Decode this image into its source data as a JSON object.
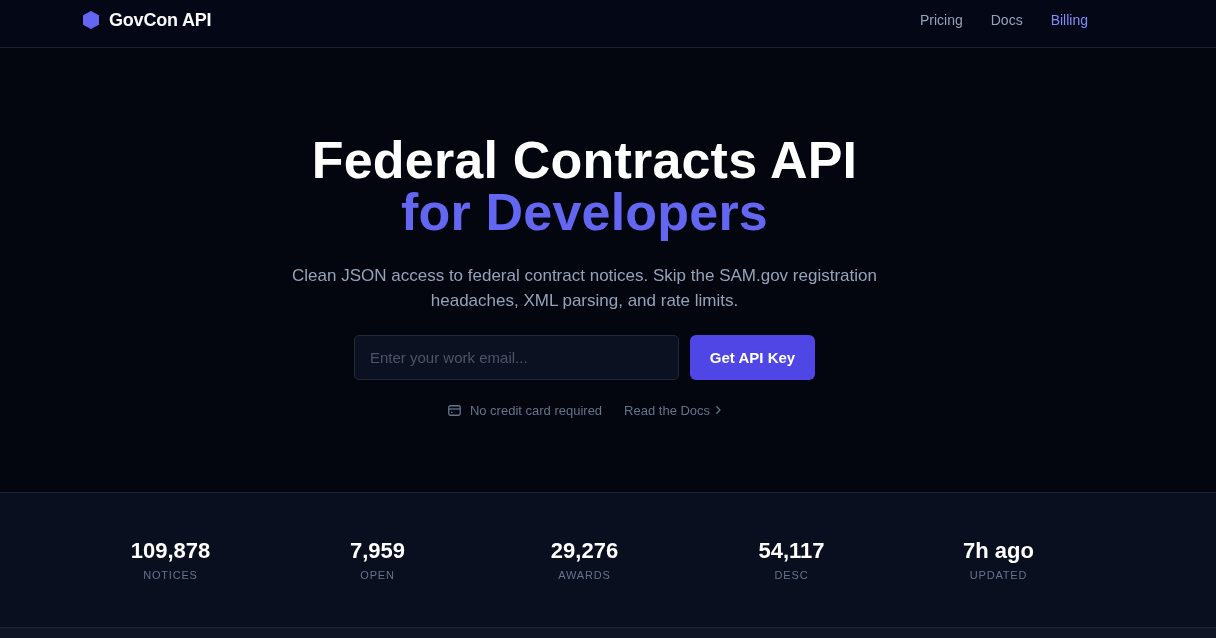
{
  "header": {
    "logo_text": "GovCon API",
    "nav": [
      {
        "label": "Pricing",
        "selected": false
      },
      {
        "label": "Docs",
        "selected": false
      },
      {
        "label": "Billing",
        "selected": true
      }
    ]
  },
  "hero": {
    "title_line_1": "Federal Contracts API",
    "title_line_2": "for Developers",
    "subtitle": "Clean JSON access to federal contract notices. Skip the SAM.gov registration headaches, XML parsing, and rate limits.",
    "email_field": {
      "placeholder": "Enter your work email..."
    },
    "cta_button": "Get API Key",
    "notes": [
      {
        "kind": "note",
        "text": "No credit card required"
      },
      {
        "kind": "link",
        "text": "Read the Docs"
      }
    ]
  },
  "stats": [
    {
      "value": "109,878",
      "label": "NOTICES"
    },
    {
      "value": "7,959",
      "label": "OPEN"
    },
    {
      "value": "29,276",
      "label": "AWARDS"
    },
    {
      "value": "54,117",
      "label": "DESC"
    },
    {
      "value": "7h ago",
      "label": "UPDATED"
    }
  ]
}
